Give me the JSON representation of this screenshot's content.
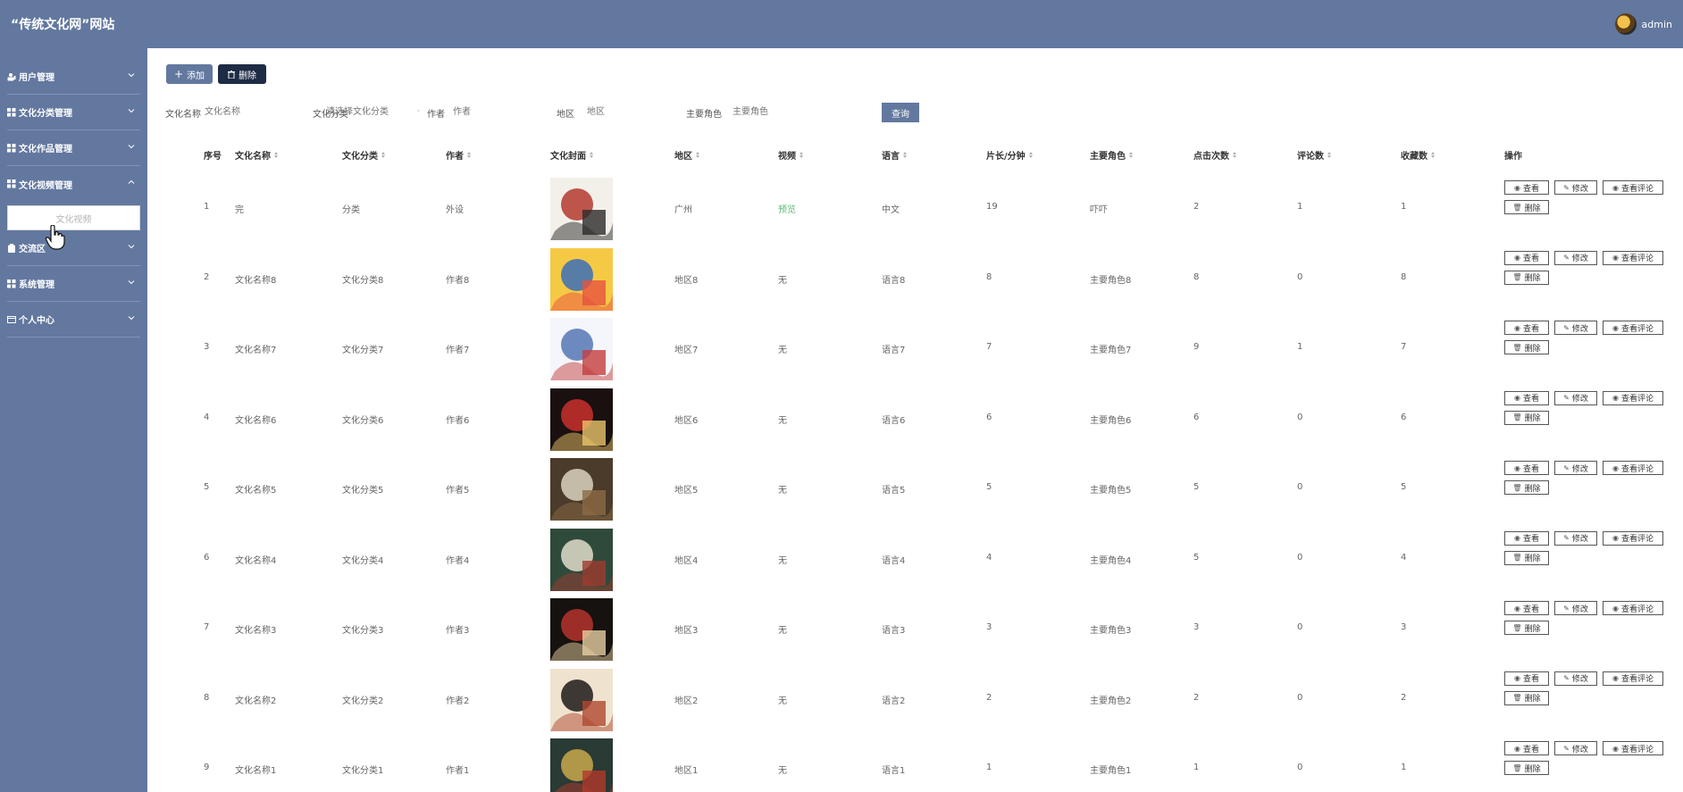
{
  "header": {
    "title": "“传统文化网”网站",
    "user": "admin"
  },
  "sidebar": {
    "items": [
      {
        "label": "用户管理",
        "icon": "user-icon",
        "expanded": false
      },
      {
        "label": "文化分类管理",
        "icon": "grid-icon",
        "expanded": false
      },
      {
        "label": "文化作品管理",
        "icon": "grid-icon",
        "expanded": false
      },
      {
        "label": "文化视频管理",
        "icon": "grid-icon",
        "expanded": true
      },
      {
        "label": "交流区",
        "icon": "clipboard-icon",
        "expanded": false
      },
      {
        "label": "系统管理",
        "icon": "grid-icon",
        "expanded": false
      },
      {
        "label": "个人中心",
        "icon": "id-card-icon",
        "expanded": false
      }
    ],
    "submenu": {
      "label": "文化视频"
    }
  },
  "toolbar": {
    "add_label": "添加",
    "delete_label": "删除"
  },
  "search": {
    "name_label": "文化名称",
    "name_placeholder": "文化名称",
    "category_label": "文化分类",
    "category_placeholder": "请选择文化分类",
    "author_label": "作者",
    "author_placeholder": "作者",
    "region_label": "地区",
    "region_placeholder": "地区",
    "role_label": "主要角色",
    "role_placeholder": "主要角色",
    "query_label": "查询"
  },
  "table": {
    "columns": [
      "序号",
      "文化名称",
      "文化分类",
      "作者",
      "文化封面",
      "地区",
      "视频",
      "语言",
      "片长/分钟",
      "主要角色",
      "点击次数",
      "评论数",
      "收藏数",
      "操作"
    ],
    "actions": {
      "view": "查看",
      "edit": "修改",
      "view_comments": "查看评论",
      "delete": "删除"
    },
    "rows": [
      {
        "no": "1",
        "name": "完",
        "category": "分类",
        "author": "外设",
        "region": "广州",
        "video": "预览",
        "language": "中文",
        "duration": "19",
        "role": "吓吓",
        "clicks": "2",
        "comments": "1",
        "favorites": "1"
      },
      {
        "no": "2",
        "name": "文化名称8",
        "category": "文化分类8",
        "author": "作者8",
        "region": "地区8",
        "video": "无",
        "language": "语言8",
        "duration": "8",
        "role": "主要角色8",
        "clicks": "8",
        "comments": "0",
        "favorites": "8"
      },
      {
        "no": "3",
        "name": "文化名称7",
        "category": "文化分类7",
        "author": "作者7",
        "region": "地区7",
        "video": "无",
        "language": "语言7",
        "duration": "7",
        "role": "主要角色7",
        "clicks": "9",
        "comments": "1",
        "favorites": "7"
      },
      {
        "no": "4",
        "name": "文化名称6",
        "category": "文化分类6",
        "author": "作者6",
        "region": "地区6",
        "video": "无",
        "language": "语言6",
        "duration": "6",
        "role": "主要角色6",
        "clicks": "6",
        "comments": "0",
        "favorites": "6"
      },
      {
        "no": "5",
        "name": "文化名称5",
        "category": "文化分类5",
        "author": "作者5",
        "region": "地区5",
        "video": "无",
        "language": "语言5",
        "duration": "5",
        "role": "主要角色5",
        "clicks": "5",
        "comments": "0",
        "favorites": "5"
      },
      {
        "no": "6",
        "name": "文化名称4",
        "category": "文化分类4",
        "author": "作者4",
        "region": "地区4",
        "video": "无",
        "language": "语言4",
        "duration": "4",
        "role": "主要角色4",
        "clicks": "5",
        "comments": "0",
        "favorites": "4"
      },
      {
        "no": "7",
        "name": "文化名称3",
        "category": "文化分类3",
        "author": "作者3",
        "region": "地区3",
        "video": "无",
        "language": "语言3",
        "duration": "3",
        "role": "主要角色3",
        "clicks": "3",
        "comments": "0",
        "favorites": "3"
      },
      {
        "no": "8",
        "name": "文化名称2",
        "category": "文化分类2",
        "author": "作者2",
        "region": "地区2",
        "video": "无",
        "language": "语言2",
        "duration": "2",
        "role": "主要角色2",
        "clicks": "2",
        "comments": "0",
        "favorites": "2"
      },
      {
        "no": "9",
        "name": "文化名称1",
        "category": "文化分类1",
        "author": "作者1",
        "region": "地区1",
        "video": "无",
        "language": "语言1",
        "duration": "1",
        "role": "主要角色1",
        "clicks": "1",
        "comments": "0",
        "favorites": "1"
      }
    ]
  },
  "colors": {
    "primary": "#63789f",
    "dark_button": "#1e2b45",
    "preview_link": "#5cb87a"
  }
}
